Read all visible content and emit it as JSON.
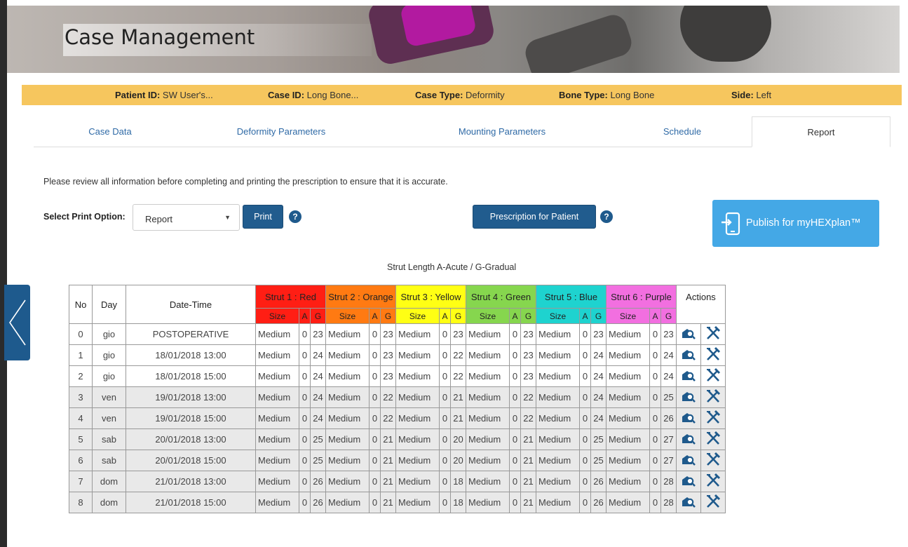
{
  "banner": {
    "title": "Case Management"
  },
  "info_bar": {
    "patient_id_label": "Patient ID:",
    "patient_id": "SW User's...",
    "case_id_label": "Case ID:",
    "case_id": "Long Bone...",
    "case_type_label": "Case Type:",
    "case_type": "Deformity",
    "bone_type_label": "Bone Type:",
    "bone_type": "Long Bone",
    "side_label": "Side:",
    "side": "Left"
  },
  "tabs": [
    "Case Data",
    "Deformity Parameters",
    "Mounting Parameters",
    "Schedule",
    "Report"
  ],
  "active_tab": "Report",
  "notice": "Please review all information before completing and printing the prescription to ensure that it is accurate.",
  "print": {
    "label": "Select Print Option:",
    "selected": "Report",
    "button": "Print"
  },
  "prescription_button": "Prescription for Patient",
  "publish_button": "Publish for myHEXplan™",
  "strut_caption": "Strut Length A-Acute / G-Gradual",
  "table": {
    "headers": {
      "no": "No",
      "day": "Day",
      "date_time": "Date-Time",
      "actions": "Actions"
    },
    "struts": [
      {
        "label": "Strut 1 : Red",
        "color": "#ff1e14"
      },
      {
        "label": "Strut 2 : Orange",
        "color": "#ff7a12"
      },
      {
        "label": "Strut 3 : Yellow",
        "color": "#ffff14"
      },
      {
        "label": "Strut 4 : Green",
        "color": "#86d64e"
      },
      {
        "label": "Strut 5 : Blue",
        "color": "#1ed3cf"
      },
      {
        "label": "Strut 6 : Purple",
        "color": "#f26fe0"
      }
    ],
    "subheaders": {
      "size": "Size",
      "a": "A",
      "g": "G"
    },
    "rows": [
      {
        "no": "0",
        "day": "gio",
        "dt": "POSTOPERATIVE",
        "g": [
          "23",
          "23",
          "23",
          "23",
          "23",
          "23"
        ]
      },
      {
        "no": "1",
        "day": "gio",
        "dt": "18/01/2018 13:00",
        "g": [
          "24",
          "23",
          "22",
          "23",
          "24",
          "24"
        ]
      },
      {
        "no": "2",
        "day": "gio",
        "dt": "18/01/2018 15:00",
        "g": [
          "24",
          "23",
          "22",
          "23",
          "24",
          "24"
        ]
      },
      {
        "no": "3",
        "day": "ven",
        "dt": "19/01/2018 13:00",
        "g": [
          "24",
          "22",
          "21",
          "22",
          "24",
          "25"
        ]
      },
      {
        "no": "4",
        "day": "ven",
        "dt": "19/01/2018 15:00",
        "g": [
          "24",
          "22",
          "21",
          "22",
          "24",
          "26"
        ]
      },
      {
        "no": "5",
        "day": "sab",
        "dt": "20/01/2018 13:00",
        "g": [
          "25",
          "21",
          "20",
          "21",
          "25",
          "27"
        ]
      },
      {
        "no": "6",
        "day": "sab",
        "dt": "20/01/2018 15:00",
        "g": [
          "25",
          "21",
          "20",
          "21",
          "25",
          "27"
        ]
      },
      {
        "no": "7",
        "day": "dom",
        "dt": "21/01/2018 13:00",
        "g": [
          "26",
          "21",
          "18",
          "21",
          "26",
          "28"
        ]
      },
      {
        "no": "8",
        "day": "dom",
        "dt": "21/01/2018 15:00",
        "g": [
          "26",
          "21",
          "18",
          "21",
          "26",
          "28"
        ]
      }
    ],
    "size_value": "Medium",
    "a_value": "0",
    "row_icons": [
      "view-icon",
      "adjust-icon"
    ]
  }
}
